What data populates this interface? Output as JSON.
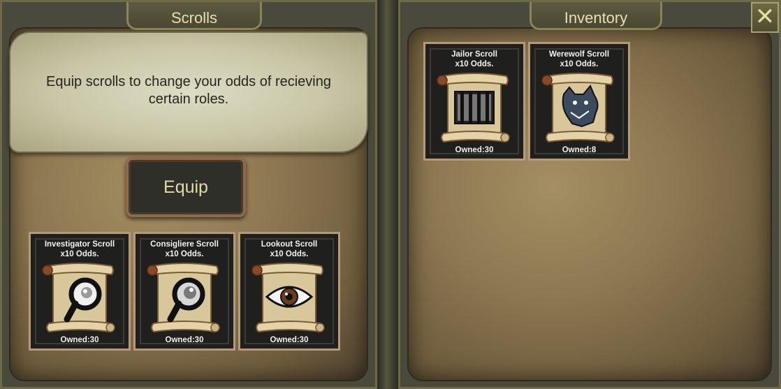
{
  "scrolls_panel": {
    "tab_title": "Scrolls",
    "info_text": "Equip scrolls to change your odds of recieving certain roles.",
    "equip_label": "Equip",
    "cards": [
      {
        "title": "Investigator Scroll",
        "odds": "x10 Odds.",
        "owned": "Owned:30",
        "icon": "magnifier-icon"
      },
      {
        "title": "Consigliere Scroll",
        "odds": "x10 Odds.",
        "owned": "Owned:30",
        "icon": "magnifier-icon"
      },
      {
        "title": "Lookout Scroll",
        "odds": "x10 Odds.",
        "owned": "Owned:30",
        "icon": "eye-icon"
      }
    ]
  },
  "inventory_panel": {
    "tab_title": "Inventory",
    "close_icon": "close-icon",
    "cards": [
      {
        "title": "Jailor Scroll",
        "odds": "x10 Odds.",
        "owned": "Owned:30",
        "icon": "jail-bars-icon"
      },
      {
        "title": "Werewolf Scroll",
        "odds": "x10 Odds.",
        "owned": "Owned:8",
        "icon": "werewolf-icon"
      }
    ]
  },
  "colors": {
    "panel_bg": "#4a4a3c",
    "parchment": "#c8c6a6",
    "card_border": "#b59a7a",
    "tab_text": "#e9dfb2"
  }
}
